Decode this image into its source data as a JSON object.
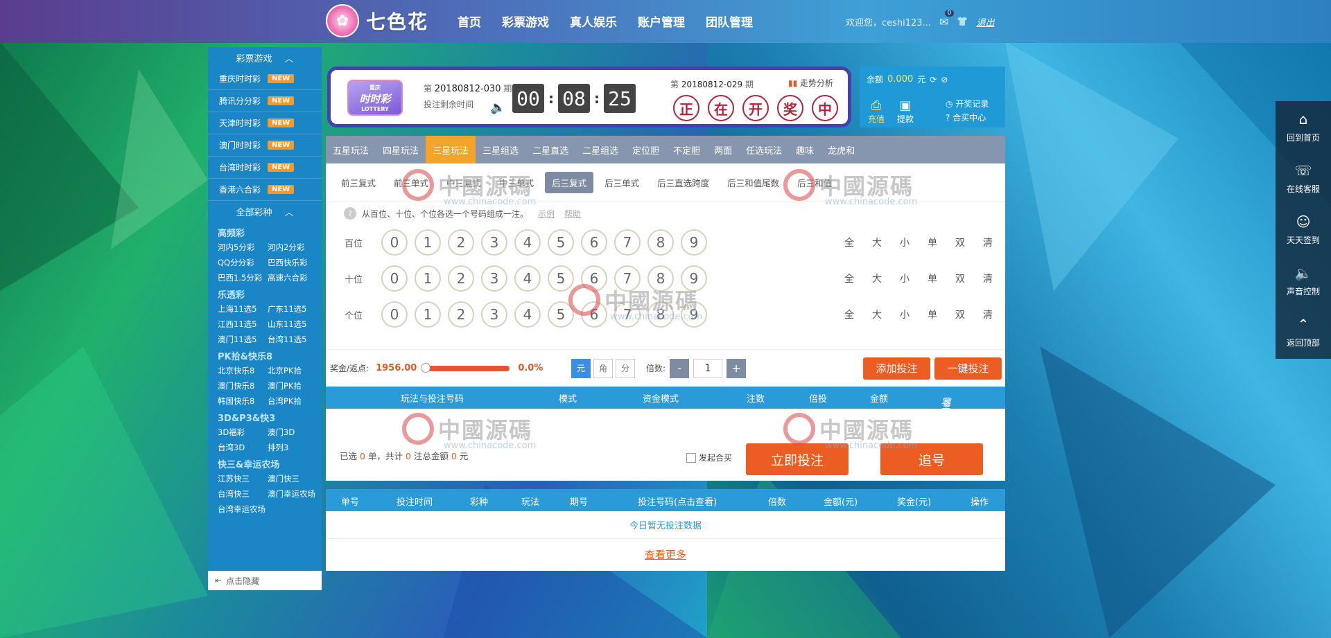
{
  "header": {
    "logo_text": "七色花",
    "nav": [
      "首页",
      "彩票游戏",
      "真人娱乐",
      "账户管理",
      "团队管理"
    ],
    "welcome": "欢迎您，ceshi123...",
    "mail_count": "0",
    "logout": "退出"
  },
  "sidebar": {
    "lottery_header": "彩票游戏",
    "hot_items": [
      {
        "label": "重庆时时彩",
        "badge": "NEW"
      },
      {
        "label": "腾讯分分彩",
        "badge": "NEW"
      },
      {
        "label": "天津时时彩",
        "badge": "NEW"
      },
      {
        "label": "澳门时时彩",
        "badge": "NEW"
      },
      {
        "label": "台湾时时彩",
        "badge": "NEW"
      },
      {
        "label": "香港六合彩",
        "badge": "NEW"
      }
    ],
    "all_header": "全部彩种",
    "categories": [
      {
        "title": "高频彩",
        "items": [
          "河内5分彩",
          "河内2分彩",
          "QQ分分彩",
          "巴西快乐彩",
          "巴西1.5分彩",
          "高速六合彩"
        ]
      },
      {
        "title": "乐透彩",
        "items": [
          "上海11选5",
          "广东11选5",
          "江西11选5",
          "山东11选5",
          "澳门11选5",
          "台湾11选5"
        ]
      },
      {
        "title": "PK拾&快乐8",
        "items": [
          "北京快乐8",
          "北京PK拾",
          "澳门快乐8",
          "澳门PK拾",
          "韩国快乐8",
          "台湾PK拾"
        ]
      },
      {
        "title": "3D&P3&快3",
        "items": [
          "3D福彩",
          "澳门3D",
          "台湾3D",
          "排列3"
        ]
      },
      {
        "title": "快三&幸运农场",
        "items": [
          "江苏快三",
          "澳门快三",
          "台湾快三",
          "澳门幸运农场",
          "台湾幸运农场"
        ]
      }
    ],
    "hide": "点击隐藏"
  },
  "ticket": {
    "logo_top": "重庆",
    "logo_main": "时时彩",
    "logo_sub": "LOTTERY",
    "issue_prefix": "第",
    "issue": "20180812-030",
    "issue_suffix": "期",
    "remaining_label": "投注剩余时间",
    "timer": [
      "00",
      "08",
      "25"
    ],
    "prev_issue": "20180812-029",
    "trend_label": "走势分析",
    "result_chars": [
      "正",
      "在",
      "开",
      "奖",
      "中"
    ]
  },
  "account": {
    "balance_label": "余额",
    "balance": "0.000",
    "unit": "元",
    "recharge": "充值",
    "withdraw": "提款",
    "draw_record": "开奖记录",
    "help_center": "合买中心"
  },
  "play_tabs": [
    "五星玩法",
    "四星玩法",
    "三星玩法",
    "三星组选",
    "二星直选",
    "二星组选",
    "定位胆",
    "不定胆",
    "两面",
    "任选玩法",
    "趣味",
    "龙虎和"
  ],
  "play_tabs_active": 2,
  "sub_tabs": [
    "前三复式",
    "前三单式",
    "中三复式",
    "中三单式",
    "后三复式",
    "后三单式",
    "后三直选跨度",
    "后三和值尾数",
    "后三和值"
  ],
  "sub_tabs_active": 4,
  "hint": {
    "text": "从百位、十位、个位各选一个号码组成一注。",
    "example": "示例",
    "help": "帮助"
  },
  "rows": [
    {
      "label": "百位"
    },
    {
      "label": "十位"
    },
    {
      "label": "个位"
    }
  ],
  "digits": [
    "0",
    "1",
    "2",
    "3",
    "4",
    "5",
    "6",
    "7",
    "8",
    "9"
  ],
  "quick_picks": [
    "全",
    "大",
    "小",
    "单",
    "双",
    "清"
  ],
  "betbar": {
    "rate_label": "奖金/返点:",
    "prize": "1956.00",
    "rebate": "0.0%",
    "units": [
      "元",
      "角",
      "分"
    ],
    "multiple_label": "倍数:",
    "multiple": "1",
    "minus": "-",
    "plus": "+",
    "add_bet": "添加投注",
    "quick_bet": "一键投注"
  },
  "order_columns": [
    "玩法与投注号码",
    "模式",
    "资金模式",
    "注数",
    "倍投",
    "金额",
    "全删"
  ],
  "summary": {
    "prefix": "已选",
    "count": "0",
    "mid1": "单，共计",
    "bets": "0",
    "mid2": "注总金额",
    "amount": "0",
    "suffix": "元"
  },
  "syndicate": "发起合买",
  "submit": "立即投注",
  "chase": "追号",
  "records": {
    "columns": [
      "单号",
      "投注时间",
      "彩种",
      "玩法",
      "期号",
      "投注号码(点击查看)",
      "倍数",
      "金额(元)",
      "奖金(元)",
      "操作"
    ],
    "empty": "今日暂无投注数据",
    "more": "查看更多"
  },
  "right_panel": [
    {
      "icon": "home-icon",
      "label": "回到首页"
    },
    {
      "icon": "support-icon",
      "label": "在线客服"
    },
    {
      "icon": "checkin-icon",
      "label": "天天签到"
    },
    {
      "icon": "sound-icon",
      "label": "声音控制"
    },
    {
      "icon": "top-icon",
      "label": "返回顶部"
    }
  ],
  "watermark": {
    "big": "中國源碼",
    "small": "www.chinacode.com"
  }
}
